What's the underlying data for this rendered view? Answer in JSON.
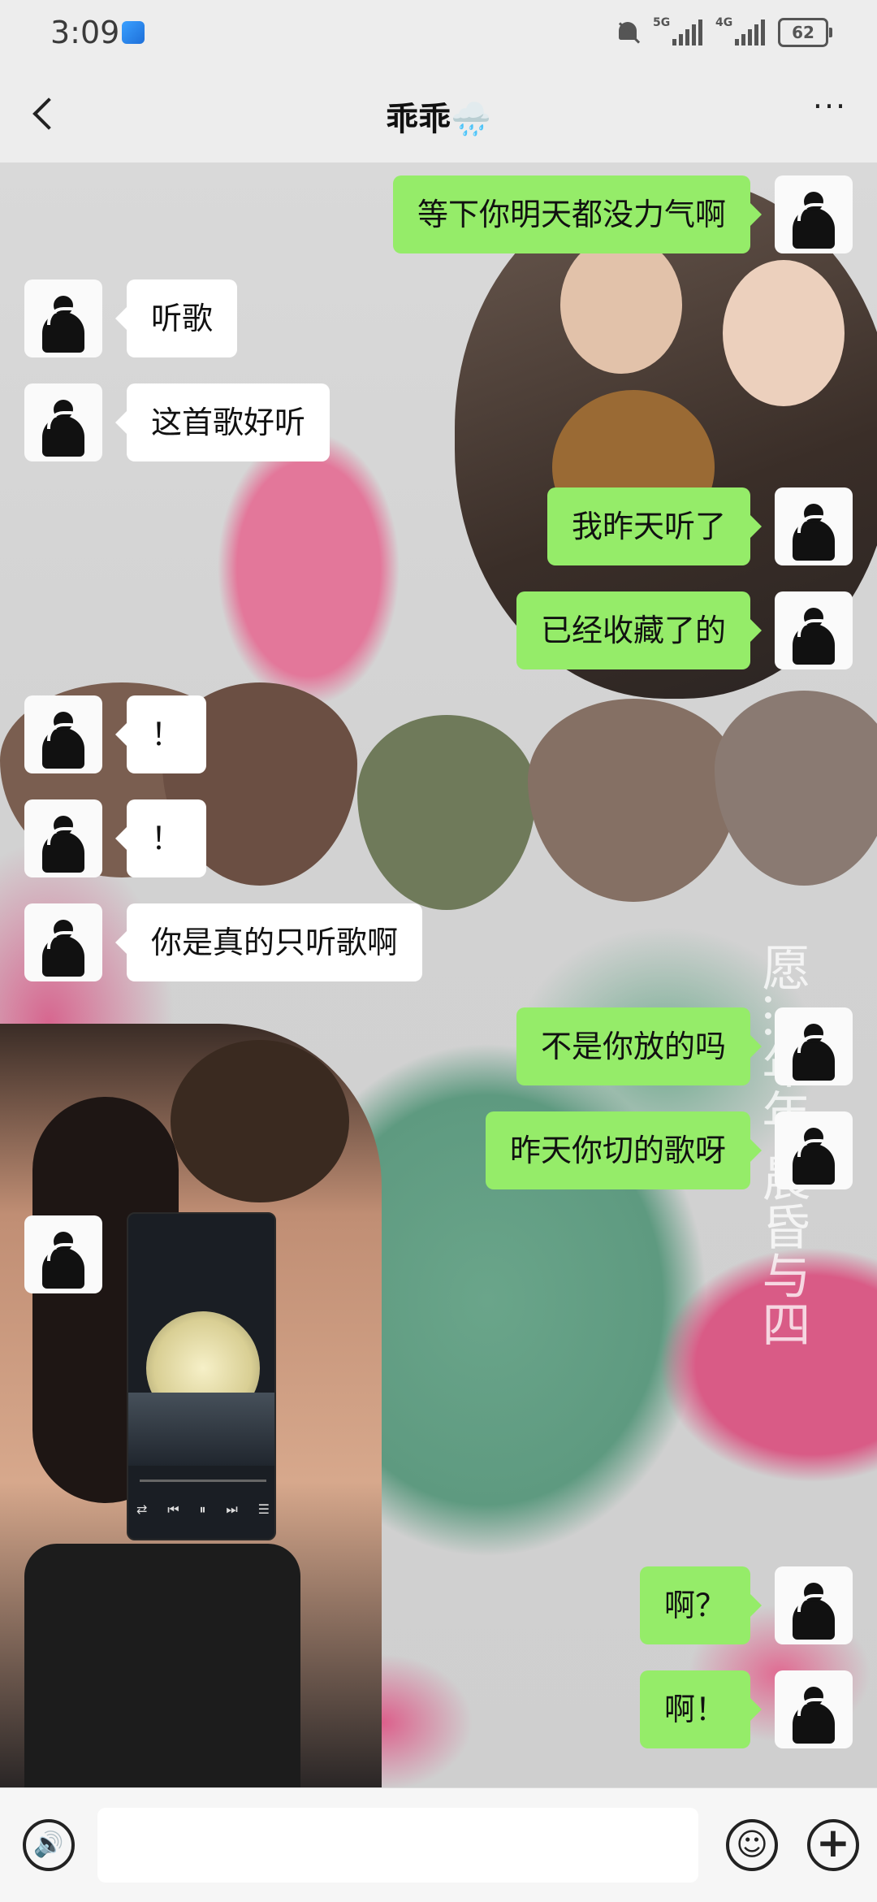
{
  "status_bar": {
    "time": "3:09",
    "signal1_tag": "5G",
    "signal2_tag": "4G",
    "battery": "62"
  },
  "title_bar": {
    "title": "乖乖🌧️",
    "back_icon": "chevron-left-icon",
    "more_icon": "more-dots-icon",
    "more_glyph": "···"
  },
  "messages": [
    {
      "side": "right",
      "text": "等下你明天都没力气啊"
    },
    {
      "side": "left",
      "text": "听歌"
    },
    {
      "side": "left",
      "text": "这首歌好听"
    },
    {
      "side": "right",
      "text": "我昨天听了"
    },
    {
      "side": "right",
      "text": "已经收藏了的"
    },
    {
      "side": "left",
      "text": "！"
    },
    {
      "side": "left",
      "text": "！"
    },
    {
      "side": "left",
      "text": "你是真的只听歌啊"
    },
    {
      "side": "right",
      "text": "不是你放的吗"
    },
    {
      "side": "right",
      "text": "昨天你切的歌呀"
    },
    {
      "side": "left",
      "type": "image"
    },
    {
      "side": "right",
      "text": "啊？"
    },
    {
      "side": "right",
      "text": "啊！"
    }
  ],
  "background_scribble": "愿…年年 晨昏与四",
  "input_bar": {
    "voice_icon": "voice-icon",
    "voice_glyph": "🔊",
    "emoji_icon": "emoji-icon",
    "emoji_glyph": "☺",
    "plus_icon": "plus-icon",
    "plus_glyph": "+",
    "placeholder": ""
  },
  "colors": {
    "bubble_green": "#95ec69",
    "bubble_white": "#ffffff",
    "bar_bg": "#ededed"
  }
}
